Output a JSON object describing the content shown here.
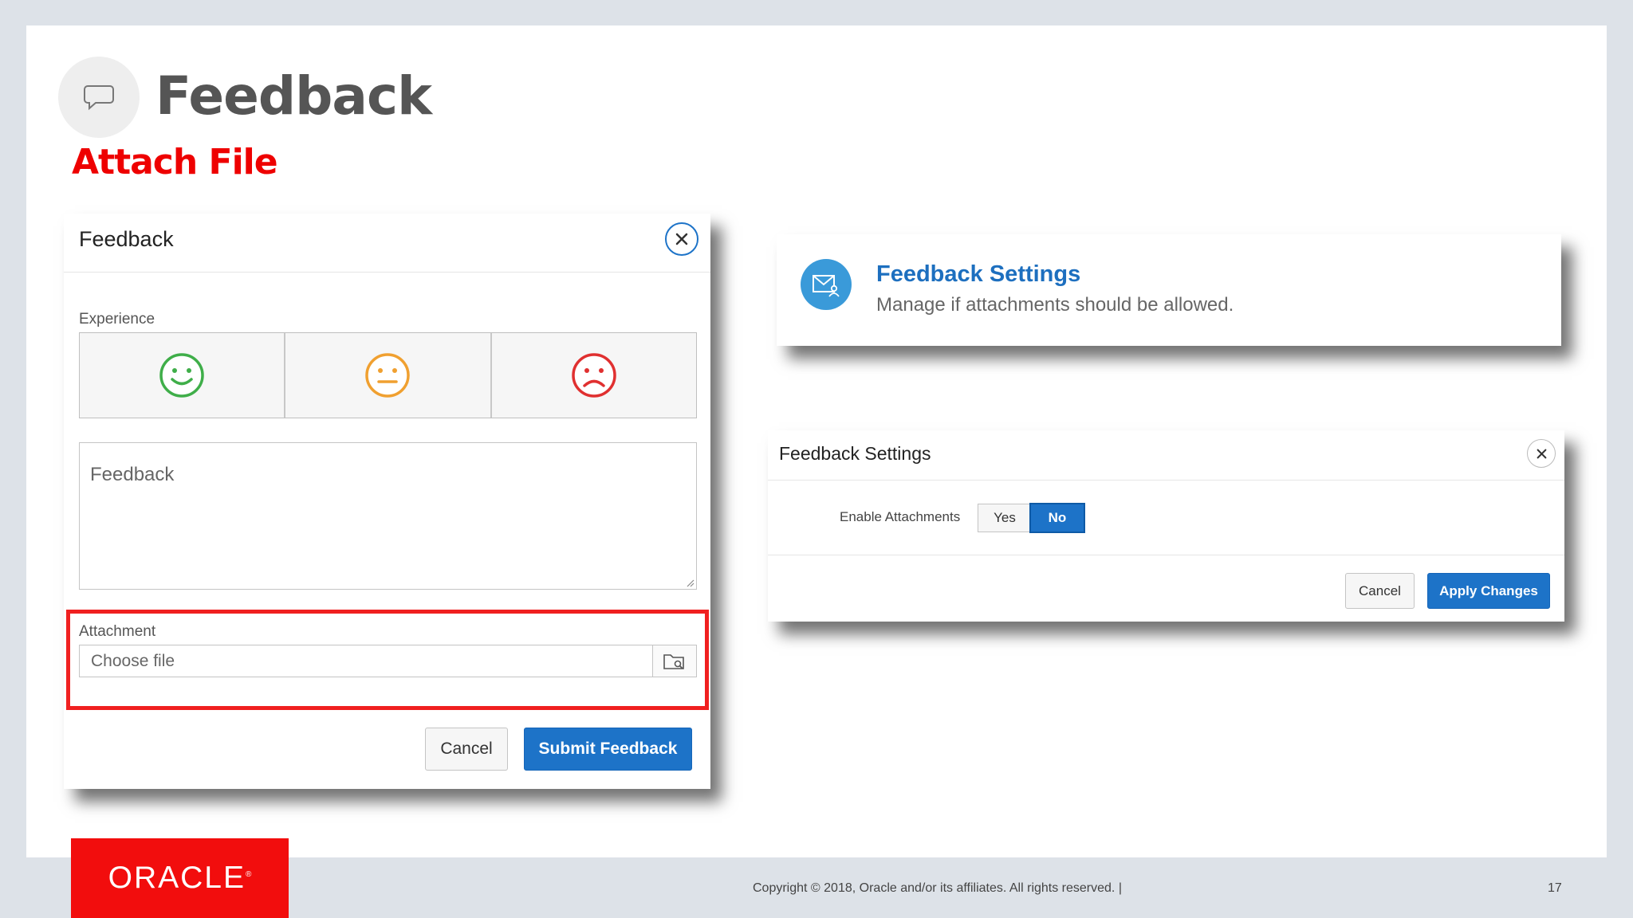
{
  "slide": {
    "title": "Feedback",
    "subtitle": "Attach File"
  },
  "feedback_dialog": {
    "title": "Feedback",
    "experience_label": "Experience",
    "faces": [
      "happy-face-icon",
      "neutral-face-icon",
      "sad-face-icon"
    ],
    "face_colors": [
      "#3fae49",
      "#f0a030",
      "#e03030"
    ],
    "feedback_placeholder": "Feedback",
    "attachment_label": "Attachment",
    "file_placeholder": "Choose file",
    "cancel_label": "Cancel",
    "submit_label": "Submit Feedback"
  },
  "settings_card": {
    "title": "Feedback Settings",
    "description": "Manage if attachments should be allowed."
  },
  "settings_dialog": {
    "title": "Feedback Settings",
    "enable_label": "Enable Attachments",
    "yes_label": "Yes",
    "no_label": "No",
    "selected": "No",
    "cancel_label": "Cancel",
    "apply_label": "Apply Changes"
  },
  "footer": {
    "brand": "ORACLE",
    "copyright": "Copyright © 2018, Oracle and/or its affiliates. All rights reserved.  |",
    "page_number": "17"
  },
  "colors": {
    "accent_red": "#ee0000",
    "primary_blue": "#1d73c8",
    "link_blue": "#1d6fbf",
    "oracle_red": "#f20d0d"
  }
}
